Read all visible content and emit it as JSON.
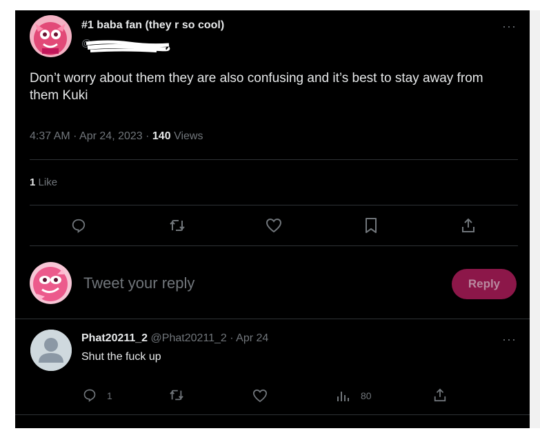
{
  "main_tweet": {
    "display_name": "#1 baba fan (they r so cool)",
    "handle_prefix": "@",
    "text": "Don’t worry about them they are also confusing and it’s best to stay away from them Kuki",
    "time": "4:37 AM",
    "date": "Apr 24, 2023",
    "views_count": "140",
    "views_label": "Views",
    "likes_count": "1",
    "likes_label": "Like",
    "more_label": "···"
  },
  "reply_composer": {
    "placeholder": "Tweet your reply",
    "button_label": "Reply"
  },
  "reply_tweet": {
    "display_name": "Phat20211_2",
    "handle": "@Phat20211_2",
    "date": "Apr 24",
    "text": "Shut the fuck up",
    "reply_count": "1",
    "views_count": "80",
    "more_label": "···"
  },
  "colors": {
    "background": "#000000",
    "text": "#e7e9ea",
    "muted": "#71767b",
    "divider": "#2f3336",
    "reply_button": "#8c1749"
  },
  "icons": {
    "action_bar": [
      "reply-icon",
      "retweet-icon",
      "like-icon",
      "bookmark-icon",
      "share-icon"
    ],
    "reply_actions": [
      "reply-icon",
      "retweet-icon",
      "like-icon",
      "views-icon",
      "share-icon"
    ]
  }
}
